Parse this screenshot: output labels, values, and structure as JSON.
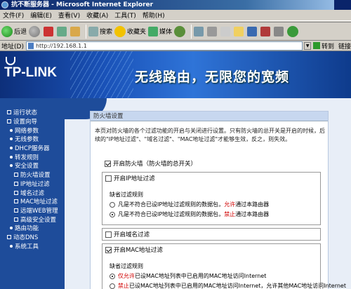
{
  "window": {
    "title": "抗不断服务器 - Microsoft Internet Explorer"
  },
  "menu": [
    "文件(F)",
    "编辑(E)",
    "查看(V)",
    "收藏(A)",
    "工具(T)",
    "帮助(H)"
  ],
  "toolbar": {
    "back": "后退",
    "search": "搜索",
    "favorites": "收藏夹",
    "media": "媒体"
  },
  "address": {
    "label": "地址(D)",
    "url": "http://192.168.1.1",
    "go": "转到",
    "links": "链接"
  },
  "banner": {
    "logo": "TP-LINK",
    "slogan": "无线路由，无限您的宽频"
  },
  "sidebar": [
    {
      "label": "运行状态",
      "level": 0
    },
    {
      "label": "设置向导",
      "level": 0
    },
    {
      "label": "网络参数",
      "level": 1
    },
    {
      "label": "无线参数",
      "level": 1
    },
    {
      "label": "DHCP服务器",
      "level": 1
    },
    {
      "label": "转发规则",
      "level": 1
    },
    {
      "label": "安全设置",
      "level": 1
    },
    {
      "label": "防火墙设置",
      "level": 2
    },
    {
      "label": "IP地址过滤",
      "level": 2
    },
    {
      "label": "域名过滤",
      "level": 2
    },
    {
      "label": "MAC地址过滤",
      "level": 2
    },
    {
      "label": "远端WEB管理",
      "level": 2
    },
    {
      "label": "高级安全设置",
      "level": 2
    },
    {
      "label": "路由功能",
      "level": 1
    },
    {
      "label": "动态DNS",
      "level": 0
    },
    {
      "label": "系统工具",
      "level": 1
    }
  ],
  "panel": {
    "header": "防火墙设置",
    "description": "本页对防火墙的各个过滤功能的开启与关闭进行设置。只有防火墙的总开关是开启的时候，后续的\"IP地址过滤\"、\"域名过滤\"、\"MAC地址过滤\"才能够生效，反之，则失效。",
    "enable_firewall": "开启防火墙（防火墙的总开关）",
    "ip_filter": {
      "label": "开启IP地址过滤",
      "default_rule_label": "缺省过滤规则",
      "rule_allow_prefix": "凡是不符合已设IP地址过滤规则的数据包，",
      "rule_allow_emph": "允许",
      "rule_allow_suffix": "通过本路由器",
      "rule_deny_prefix": "凡是不符合已设IP地址过滤规则的数据包，",
      "rule_deny_emph": "禁止",
      "rule_deny_suffix": "通过本路由器"
    },
    "domain_filter": "开启域名过滤",
    "mac_filter": {
      "label": "开启MAC地址过滤",
      "default_rule_label": "缺省过滤规则",
      "rule_allow_emph": "仅允许",
      "rule_allow_text": "已设MAC地址列表中已启用的MAC地址访问Internet",
      "rule_deny_emph": "禁止",
      "rule_deny_text": "已设MAC地址列表中已启用的MAC地址访问Internet，允许其他MAC地址访问Internet"
    }
  }
}
